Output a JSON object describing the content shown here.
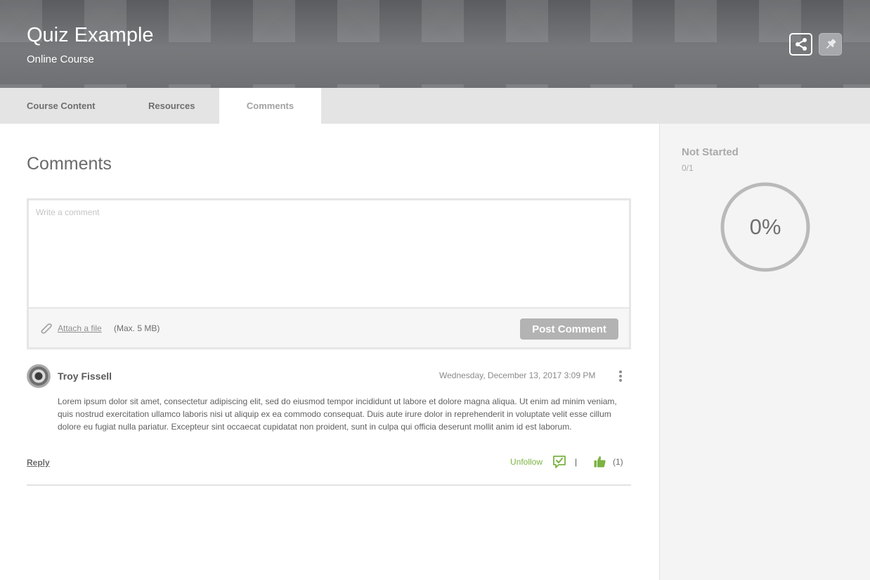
{
  "header": {
    "title": "Quiz Example",
    "subtitle": "Online Course",
    "share_icon": "share-icon",
    "pin_icon": "pin-icon"
  },
  "tabs": [
    {
      "label": "Course Content",
      "active": false
    },
    {
      "label": "Resources",
      "active": false
    },
    {
      "label": "Comments",
      "active": true
    }
  ],
  "main": {
    "section_title": "Comments",
    "composer": {
      "placeholder": "Write a comment",
      "value": "",
      "attach_label": "Attach a file",
      "max_size": "(Max. 5 MB)",
      "post_label": "Post Comment"
    },
    "comments": [
      {
        "author": "Troy Fissell",
        "timestamp": "Wednesday, December 13, 2017 3:09 PM",
        "body": "Lorem ipsum dolor sit amet, consectetur adipiscing elit, sed do eiusmod tempor incididunt ut labore et dolore magna aliqua. Ut enim ad minim veniam, quis nostrud exercitation ullamco laboris nisi ut aliquip ex ea commodo consequat. Duis aute irure dolor in reprehenderit in voluptate velit esse cillum dolore eu fugiat nulla pariatur. Excepteur sint occaecat cupidatat non proident, sunt in culpa qui officia deserunt mollit anim id est laborum.",
        "reply_label": "Reply",
        "unfollow_label": "Unfollow",
        "separator": "|",
        "like_count": "(1)"
      }
    ]
  },
  "sidebar": {
    "status": "Not Started",
    "count": "0/1",
    "progress_label": "0%",
    "progress_fraction": 0
  },
  "colors": {
    "accent_green": "#7cb342",
    "button_gray": "#b3b3b3",
    "ring_gray": "#b9b9b9"
  }
}
